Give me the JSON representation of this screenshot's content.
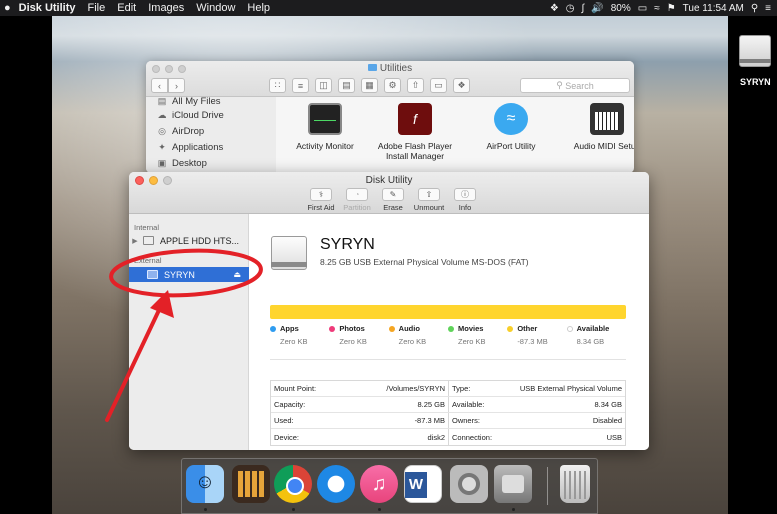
{
  "menubar": {
    "apple_icon": "apple-icon",
    "app_name": "Disk Utility",
    "items": [
      "File",
      "Edit",
      "Images",
      "Window",
      "Help"
    ],
    "battery": "80%",
    "clock": "Tue 11:54 AM"
  },
  "desktop": {
    "drive_label": "SYRYN"
  },
  "finder": {
    "title": "Utilities",
    "search_placeholder": "Search",
    "sidebar_items": [
      {
        "label": "All My Files",
        "icon": "files-icon"
      },
      {
        "label": "iCloud Drive",
        "icon": "cloud-icon"
      },
      {
        "label": "AirDrop",
        "icon": "airdrop-icon"
      },
      {
        "label": "Applications",
        "icon": "applications-icon"
      },
      {
        "label": "Desktop",
        "icon": "desktop-icon"
      }
    ],
    "apps": [
      {
        "label": "Activity Monitor"
      },
      {
        "label": "Adobe Flash Player Install Manager"
      },
      {
        "label": "AirPort Utility"
      },
      {
        "label": "Audio MIDI Setup"
      }
    ]
  },
  "disk_utility": {
    "title": "Disk Utility",
    "toolbar": [
      {
        "label": "First Aid",
        "icon": "stethoscope-icon",
        "enabled": true
      },
      {
        "label": "Partition",
        "icon": "partition-icon",
        "enabled": false
      },
      {
        "label": "Erase",
        "icon": "erase-icon",
        "enabled": true
      },
      {
        "label": "Unmount",
        "icon": "unmount-icon",
        "enabled": true
      },
      {
        "label": "Info",
        "icon": "info-icon",
        "enabled": true
      }
    ],
    "sidebar": {
      "internal_header": "Internal",
      "internal_item": "APPLE HDD HTS...",
      "external_header": "External",
      "external_item": "SYRYN"
    },
    "volume": {
      "name": "SYRYN",
      "description": "8.25 GB USB External Physical Volume MS-DOS (FAT)"
    },
    "usage_color": "#ffd52e",
    "legend": [
      {
        "name": "Apps",
        "value": "Zero KB",
        "color": "#2e9cf0"
      },
      {
        "name": "Photos",
        "value": "Zero KB",
        "color": "#ef3b7a"
      },
      {
        "name": "Audio",
        "value": "Zero KB",
        "color": "#f5a623"
      },
      {
        "name": "Movies",
        "value": "Zero KB",
        "color": "#5fd35a"
      },
      {
        "name": "Other",
        "value": "-87.3 MB",
        "color": "#f8cf2a"
      },
      {
        "name": "Available",
        "value": "8.34 GB",
        "color": "#ffffff"
      }
    ],
    "info": [
      {
        "l_label": "Mount Point:",
        "l_value": "/Volumes/SYRYN",
        "r_label": "Type:",
        "r_value": "USB External Physical Volume"
      },
      {
        "l_label": "Capacity:",
        "l_value": "8.25 GB",
        "r_label": "Available:",
        "r_value": "8.34 GB"
      },
      {
        "l_label": "Used:",
        "l_value": "-87.3 MB",
        "r_label": "Owners:",
        "r_value": "Disabled"
      },
      {
        "l_label": "Device:",
        "l_value": "disk2",
        "r_label": "Connection:",
        "r_value": "USB"
      }
    ]
  },
  "annotation_color": "#e32127",
  "dock": {
    "icons": [
      "finder-icon",
      "calculator-icon",
      "chrome-icon",
      "safari-icon",
      "itunes-icon",
      "word-icon",
      "system-preferences-icon",
      "disk-utility-icon",
      "trash-icon"
    ]
  }
}
